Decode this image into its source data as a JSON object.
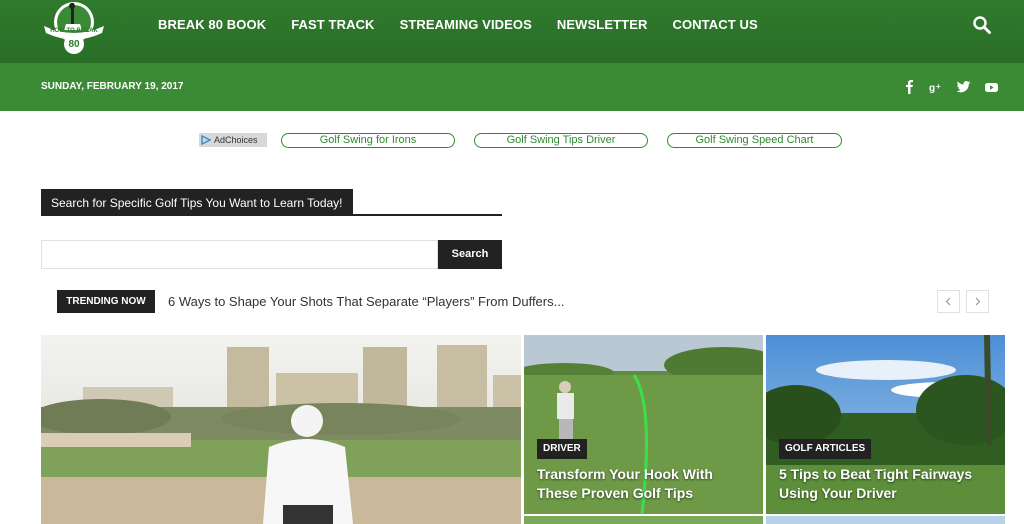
{
  "brand": {
    "logo_text": "HOW TO BREAK",
    "logo_number": "80"
  },
  "nav": {
    "items": [
      "BREAK 80 BOOK",
      "FAST TRACK",
      "STREAMING VIDEOS",
      "NEWSLETTER",
      "CONTACT US"
    ]
  },
  "topbar": {
    "date": "SUNDAY, FEBRUARY 19, 2017"
  },
  "ads": {
    "adchoices_label": "AdChoices",
    "links": [
      "Golf Swing for Irons",
      "Golf Swing Tips Driver",
      "Golf Swing Speed Chart"
    ]
  },
  "search": {
    "title": "Search for Specific Golf Tips You Want to Learn Today!",
    "value": "",
    "placeholder": "",
    "button_label": "Search"
  },
  "trending": {
    "label": "TRENDING NOW",
    "headline": "6 Ways to Shape Your Shots That Separate “Players” From Duffers..."
  },
  "featured": [
    {
      "category": "",
      "title": ""
    },
    {
      "category": "DRIVER",
      "title": "Transform Your Hook With These Proven Golf Tips"
    },
    {
      "category": "GOLF ARTICLES",
      "title": "5 Tips to Beat Tight Fairways Using Your Driver"
    }
  ]
}
